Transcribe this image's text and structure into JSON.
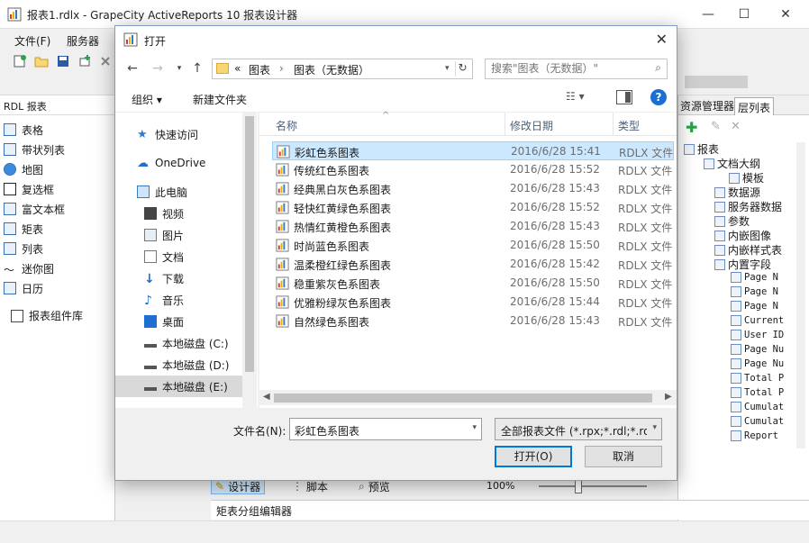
{
  "app": {
    "title": "报表1.rdlx - GrapeCity ActiveReports 10 报表设计器",
    "menus": [
      "文件(F)",
      "服务器"
    ],
    "left_panel": {
      "header": "RDL 报表",
      "tools": [
        "表格",
        "带状列表",
        "地图",
        "复选框",
        "富文本框",
        "矩表",
        "列表",
        "迷你图",
        "日历"
      ],
      "library": "报表组件库"
    },
    "right_panel": {
      "tabs": [
        "资源管理器",
        "层列表"
      ],
      "tree": [
        {
          "label": "报表",
          "indent": 0
        },
        {
          "label": "文档大纲",
          "indent": 1
        },
        {
          "label": "模板",
          "indent": 2
        },
        {
          "label": "数据源",
          "indent": 1
        },
        {
          "label": "服务器数据",
          "indent": 1
        },
        {
          "label": "参数",
          "indent": 1
        },
        {
          "label": "内嵌图像",
          "indent": 1
        },
        {
          "label": "内嵌样式表",
          "indent": 1
        },
        {
          "label": "内置字段",
          "indent": 1
        }
      ],
      "fields": [
        "Page N",
        "Page N",
        "Page N",
        "Current",
        "User ID",
        "Page Nu",
        "Page Nu",
        "Total P",
        "Total P",
        "Cumulat",
        "Cumulat",
        "Report"
      ]
    },
    "bottom_tabs": [
      "设计器",
      "脚本",
      "预览"
    ],
    "zoom": "100%",
    "matrix_editor": "矩表分组编辑器"
  },
  "dialog": {
    "title": "打开",
    "breadcrumb": [
      "«",
      "图表",
      "图表（无数据）"
    ],
    "search_placeholder": "搜索\"图表（无数据）\"",
    "organize": "组织 ▾",
    "new_folder": "新建文件夹",
    "help": "?",
    "nav_items": [
      {
        "label": "快速访问",
        "icon": "star-icon"
      },
      {
        "label": "OneDrive",
        "icon": "cloud-icon"
      },
      {
        "label": "此电脑",
        "icon": "computer-icon"
      },
      {
        "label": "视频",
        "icon": "video-icon"
      },
      {
        "label": "图片",
        "icon": "picture-icon"
      },
      {
        "label": "文档",
        "icon": "document-icon"
      },
      {
        "label": "下载",
        "icon": "download-icon"
      },
      {
        "label": "音乐",
        "icon": "music-icon"
      },
      {
        "label": "桌面",
        "icon": "desktop-icon"
      },
      {
        "label": "本地磁盘 (C:)",
        "icon": "drive-icon"
      },
      {
        "label": "本地磁盘 (D:)",
        "icon": "drive-icon"
      },
      {
        "label": "本地磁盘 (E:)",
        "icon": "drive-icon"
      }
    ],
    "columns": {
      "name": "名称",
      "date": "修改日期",
      "type": "类型"
    },
    "files": [
      {
        "name": "彩虹色系图表",
        "date": "2016/6/28 15:41",
        "type": "RDLX 文件"
      },
      {
        "name": "传统红色系图表",
        "date": "2016/6/28 15:52",
        "type": "RDLX 文件"
      },
      {
        "name": "经典黑白灰色系图表",
        "date": "2016/6/28 15:43",
        "type": "RDLX 文件"
      },
      {
        "name": "轻快红黄绿色系图表",
        "date": "2016/6/28 15:52",
        "type": "RDLX 文件"
      },
      {
        "name": "热情红黄橙色系图表",
        "date": "2016/6/28 15:43",
        "type": "RDLX 文件"
      },
      {
        "name": "时尚蓝色系图表",
        "date": "2016/6/28 15:50",
        "type": "RDLX 文件"
      },
      {
        "name": "温柔橙红绿色系图表",
        "date": "2016/6/28 15:42",
        "type": "RDLX 文件"
      },
      {
        "name": "稳重紫灰色系图表",
        "date": "2016/6/28 15:50",
        "type": "RDLX 文件"
      },
      {
        "name": "优雅粉绿灰色系图表",
        "date": "2016/6/28 15:44",
        "type": "RDLX 文件"
      },
      {
        "name": "自然绿色系图表",
        "date": "2016/6/28 15:43",
        "type": "RDLX 文件"
      }
    ],
    "filename_label": "文件名(N):",
    "filename_value": "彩虹色系图表",
    "filetype_value": "全部报表文件 (*.rpx;*.rdl;*.rdlx)",
    "open_button": "打开(O)",
    "cancel_button": "取消"
  },
  "colors": {
    "accent": "#0078d7",
    "selection": "#cce8ff",
    "folder": "#f6d675"
  }
}
